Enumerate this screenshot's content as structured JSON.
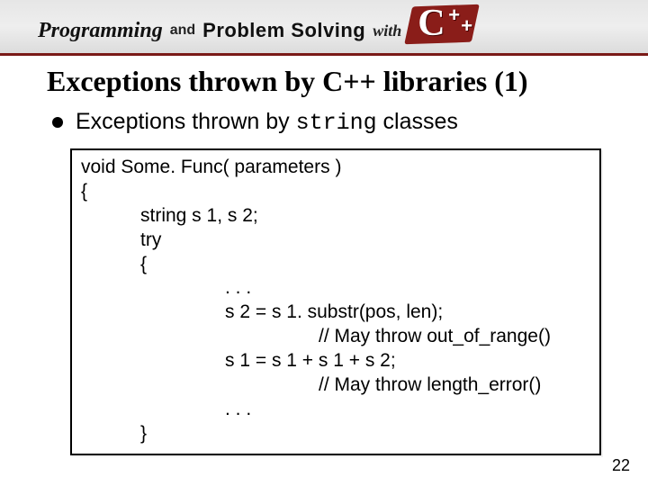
{
  "banner": {
    "programming": "Programming",
    "and": "and",
    "problem_solving": "Problem Solving",
    "with": "with",
    "cpp_letter": "C",
    "cpp_plus": "+"
  },
  "title": "Exceptions thrown by C++ libraries (1)",
  "bullet": {
    "pre": "Exceptions thrown by ",
    "mono": "string",
    "post": " classes"
  },
  "code": {
    "l0": "void Some. Func( parameters )",
    "l1": "{",
    "l2": "string s 1, s 2;",
    "l3": "try",
    "l4": "{",
    "l5": ". . .",
    "l6": "s 2 = s 1. substr(pos, len);",
    "l7": "// May throw out_of_range()",
    "l8": "s 1 = s 1 + s 1 + s 2;",
    "l9": "// May throw length_error()",
    "l10": ". . .",
    "l11": "}"
  },
  "page_number": "22"
}
